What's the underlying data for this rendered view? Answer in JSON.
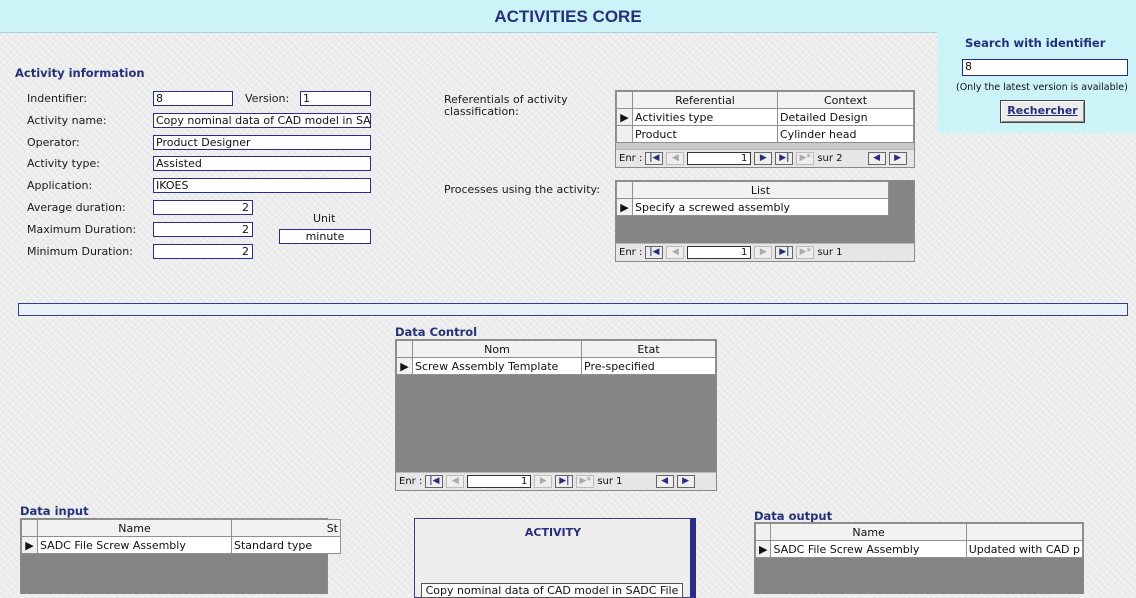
{
  "header": {
    "title": "ACTIVITIES CORE"
  },
  "search": {
    "title": "Search with identifier",
    "value": "8",
    "note": "(Only the latest version is available)",
    "button": "Rechercher"
  },
  "activity_info": {
    "section": "Activity information",
    "identifier_label": "Indentifier:",
    "identifier": "8",
    "version_label": "Version:",
    "version": "1",
    "name_label": "Activity name:",
    "name": "Copy nominal data of CAD model in SADC",
    "operator_label": "Operator:",
    "operator": "Product Designer",
    "type_label": "Activity type:",
    "type": "Assisted",
    "application_label": "Application:",
    "application": "IKOES",
    "avg_label": "Average duration:",
    "avg": "2",
    "max_label": "Maximum Duration:",
    "max": "2",
    "min_label": "Minimum Duration:",
    "min": "2",
    "unit_label": "Unit",
    "unit": "minute"
  },
  "referentials": {
    "label": "Referentials of activity classification:",
    "columns": [
      "Referential",
      "Context"
    ],
    "rows": [
      [
        "Activities type",
        "Detailed Design"
      ],
      [
        "Product",
        "Cylinder head"
      ]
    ],
    "nav": {
      "prefix": "Enr :",
      "position": "1",
      "total": "sur 2"
    }
  },
  "processes": {
    "label": "Processes using the activity:",
    "columns": [
      "List"
    ],
    "rows": [
      [
        "Specify a screwed assembly"
      ]
    ],
    "nav": {
      "prefix": "Enr :",
      "position": "1",
      "total": "sur 1"
    }
  },
  "data_control": {
    "title": "Data Control",
    "columns": [
      "Nom",
      "Etat"
    ],
    "rows": [
      [
        "Screw Assembly Template",
        "Pre-specified"
      ]
    ],
    "nav": {
      "prefix": "Enr :",
      "position": "1",
      "total": "sur 1"
    }
  },
  "data_input": {
    "title": "Data input",
    "columns": [
      "Name",
      "St"
    ],
    "rows": [
      [
        "SADC File Screw Assembly",
        "Standard type"
      ]
    ]
  },
  "activity_box": {
    "title": "ACTIVITY",
    "text": "Copy nominal data of CAD model in SADC File"
  },
  "data_output": {
    "title": "Data output",
    "columns": [
      "Name",
      ""
    ],
    "rows": [
      [
        "SADC File Screw Assembly",
        "Updated with CAD p"
      ]
    ]
  },
  "icons": [
    "row-selector-icon",
    "first-record-icon",
    "prev-record-icon",
    "next-record-icon",
    "last-record-icon",
    "new-record-icon",
    "scroll-left-icon",
    "scroll-right-icon"
  ]
}
